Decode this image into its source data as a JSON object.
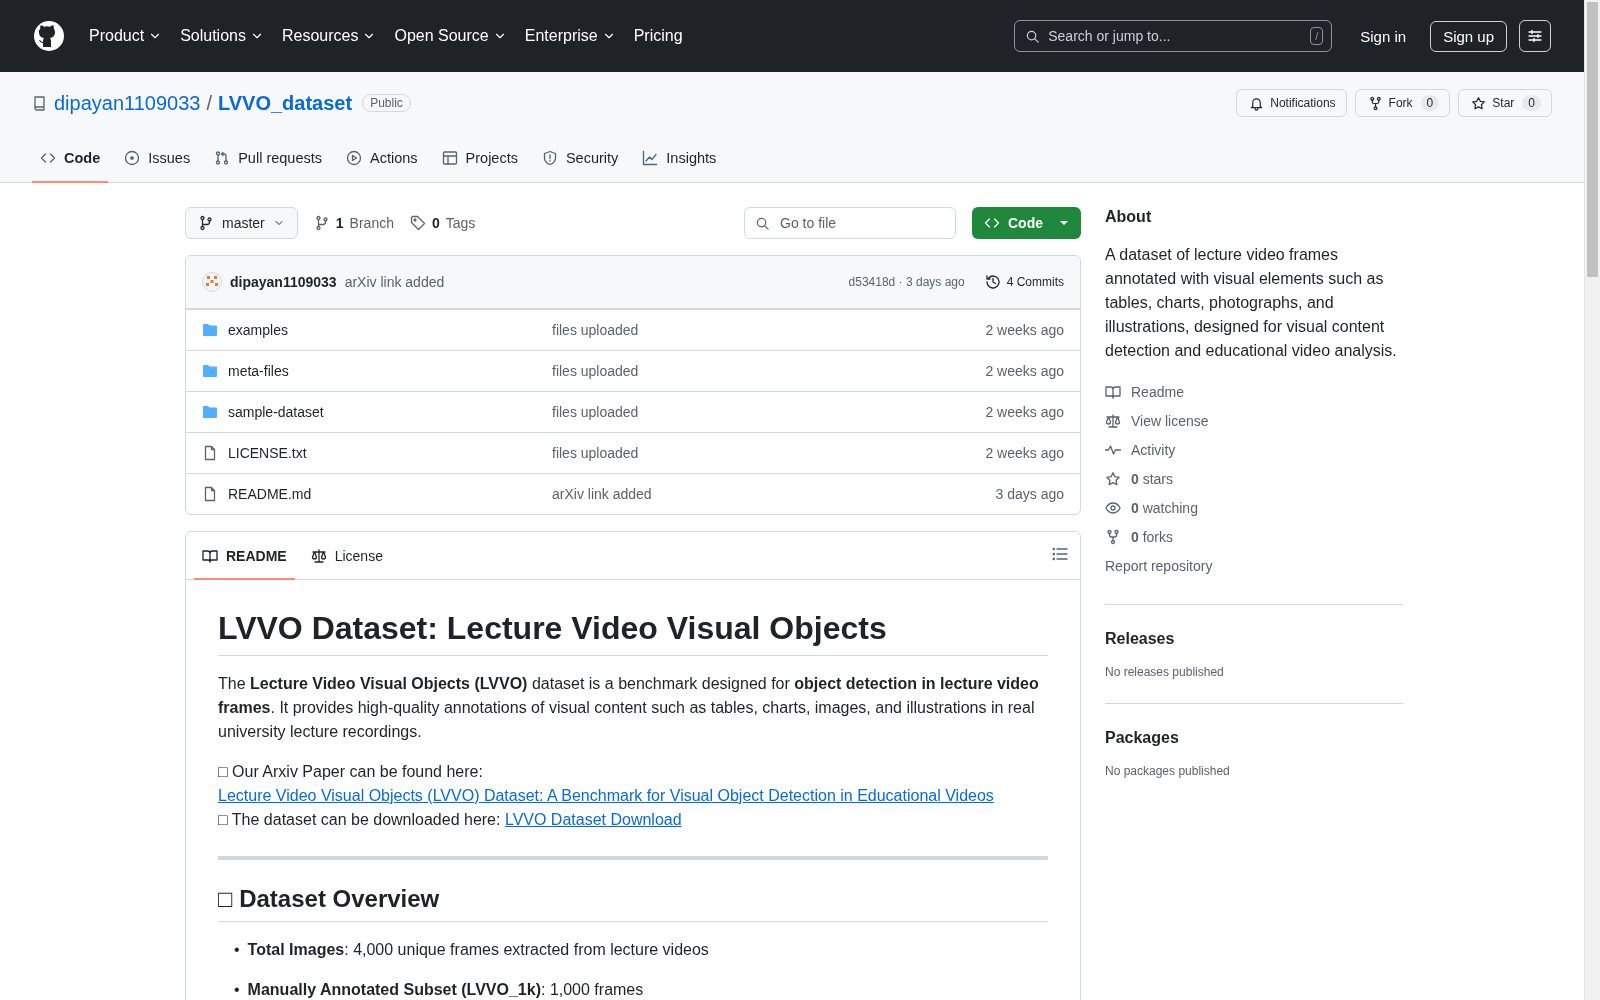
{
  "header": {
    "nav": [
      {
        "label": "Product",
        "dropdown": true
      },
      {
        "label": "Solutions",
        "dropdown": true
      },
      {
        "label": "Resources",
        "dropdown": true
      },
      {
        "label": "Open Source",
        "dropdown": true
      },
      {
        "label": "Enterprise",
        "dropdown": true
      },
      {
        "label": "Pricing",
        "dropdown": false
      }
    ],
    "search": {
      "placeholder": "Search or jump to...",
      "shortcut": "/"
    },
    "sign_in": "Sign in",
    "sign_up": "Sign up"
  },
  "repo": {
    "owner": "dipayan1109033",
    "separator": "/",
    "name": "LVVO_dataset",
    "visibility": "Public",
    "actions": [
      {
        "kind": "bell",
        "label": "Notifications"
      },
      {
        "kind": "fork",
        "label": "Fork",
        "count": "0"
      },
      {
        "kind": "star",
        "label": "Star",
        "count": "0"
      }
    ]
  },
  "tabs": [
    {
      "kind": "code",
      "label": "Code",
      "selected": true
    },
    {
      "kind": "issue",
      "label": "Issues",
      "selected": false
    },
    {
      "kind": "pull",
      "label": "Pull requests",
      "selected": false
    },
    {
      "kind": "play",
      "label": "Actions",
      "selected": false
    },
    {
      "kind": "table",
      "label": "Projects",
      "selected": false
    },
    {
      "kind": "shield",
      "label": "Security",
      "selected": false
    },
    {
      "kind": "graph",
      "label": "Insights",
      "selected": false
    }
  ],
  "branch_bar": {
    "branch": "master",
    "branches_count": "1",
    "branches_label": "Branch",
    "tags_count": "0",
    "tags_label": "Tags",
    "go_to_file": {
      "placeholder": "Go to file"
    },
    "code_button": "Code"
  },
  "latest_commit": {
    "author": "dipayan1109033",
    "message": "arXiv link added",
    "hash_time": "d53418d · 3 days ago",
    "commits": "4 Commits"
  },
  "files": [
    {
      "kind": "folder",
      "name": "examples",
      "message": "files uploaded",
      "time": "2 weeks ago"
    },
    {
      "kind": "folder",
      "name": "meta-files",
      "message": "files uploaded",
      "time": "2 weeks ago"
    },
    {
      "kind": "folder",
      "name": "sample-dataset",
      "message": "files uploaded",
      "time": "2 weeks ago"
    },
    {
      "kind": "file",
      "name": "LICENSE.txt",
      "message": "files uploaded",
      "time": "2 weeks ago"
    },
    {
      "kind": "file",
      "name": "README.md",
      "message": "arXiv link added",
      "time": "3 days ago"
    }
  ],
  "readme": {
    "tabs": [
      {
        "kind": "book",
        "label": "README",
        "selected": true
      },
      {
        "kind": "scale",
        "label": "License",
        "selected": false
      }
    ],
    "title": "LVVO Dataset: Lecture Video Visual Objects",
    "intro": "The **Lecture Video Visual Objects (LVVO)** dataset is a benchmark designed for **object detection in lecture video frames**. It provides high-quality annotations of visual content such as tables, charts, images, and illustrations in real university lecture recordings.",
    "links": [
      {
        "text": "□ Our Arxiv Paper can be found here:",
        "link": "Lecture Video Visual Objects (LVVO) Dataset: A Benchmark for Visual Object Detection in Educational Videos"
      },
      {
        "text": "□ The dataset can be downloaded here:",
        "link": "LVVO Dataset Download"
      }
    ],
    "section_title": "□ Dataset Overview",
    "items": [
      {
        "marker": "•",
        "text": "**Total Images**: 4,000 unique frames extracted from lecture videos"
      },
      {
        "marker": "•",
        "text": "**Manually Annotated Subset (LVVO_1k)**: 1,000 frames"
      }
    ]
  },
  "about": {
    "title": "About",
    "description": "A dataset of lecture video frames annotated with visual elements such as tables, charts, photographs, and illustrations, designed for visual content detection and educational video analysis.",
    "links": [
      {
        "kind": "book",
        "label": "Readme"
      },
      {
        "kind": "scale",
        "label": "View license"
      },
      {
        "kind": "pulse",
        "label": "Activity"
      },
      {
        "kind": "star",
        "count": "0",
        "label": "stars"
      },
      {
        "kind": "eye",
        "count": "0",
        "label": "watching"
      },
      {
        "kind": "fork",
        "count": "0",
        "label": "forks"
      }
    ],
    "report": "Report repository"
  },
  "releases": {
    "title": "Releases",
    "note": "No releases published"
  },
  "packages": {
    "title": "Packages",
    "note": "No packages published"
  }
}
